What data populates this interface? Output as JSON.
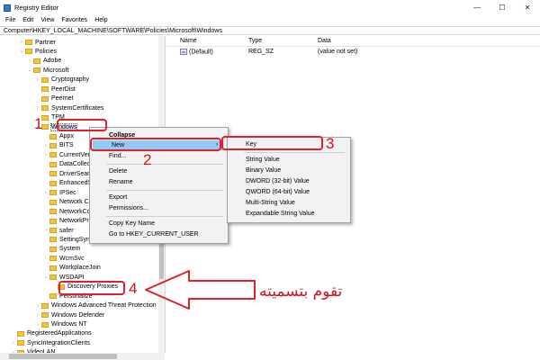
{
  "window": {
    "title": "Registry Editor",
    "controls": {
      "minimize": "—",
      "maximize": "☐",
      "close": "✕"
    }
  },
  "menubar": {
    "items": [
      "File",
      "Edit",
      "View",
      "Favorites",
      "Help"
    ]
  },
  "address": "Computer\\HKEY_LOCAL_MACHINE\\SOFTWARE\\Policies\\Microsoft\\Windows",
  "tree": {
    "items": [
      {
        "label": "Partner",
        "depth": 2,
        "expander": "›"
      },
      {
        "label": "Policies",
        "depth": 2,
        "expander": "⌄"
      },
      {
        "label": "Adobe",
        "depth": 3,
        "expander": "›"
      },
      {
        "label": "Microsoft",
        "depth": 3,
        "expander": "⌄"
      },
      {
        "label": "Cryptography",
        "depth": 4,
        "expander": "›"
      },
      {
        "label": "PeerDist",
        "depth": 4,
        "expander": ""
      },
      {
        "label": "Peernet",
        "depth": 4,
        "expander": ""
      },
      {
        "label": "SystemCertificates",
        "depth": 4,
        "expander": "›"
      },
      {
        "label": "TPM",
        "depth": 4,
        "expander": ""
      },
      {
        "label": "Windows",
        "depth": 4,
        "expander": "⌄"
      },
      {
        "label": "Appx",
        "depth": 5,
        "expander": ""
      },
      {
        "label": "BITS",
        "depth": 5,
        "expander": "›"
      },
      {
        "label": "CurrentVersion",
        "depth": 5,
        "expander": "›"
      },
      {
        "label": "DataCollection",
        "depth": 5,
        "expander": ""
      },
      {
        "label": "DriverSearching",
        "depth": 5,
        "expander": ""
      },
      {
        "label": "EnhancedStorageDevices",
        "depth": 5,
        "expander": ""
      },
      {
        "label": "IPSec",
        "depth": 5,
        "expander": "›"
      },
      {
        "label": "Network Connections",
        "depth": 5,
        "expander": ""
      },
      {
        "label": "NetworkConnectivityStatusIndicator",
        "depth": 5,
        "expander": ""
      },
      {
        "label": "NetworkProvider",
        "depth": 5,
        "expander": ""
      },
      {
        "label": "safer",
        "depth": 5,
        "expander": "›"
      },
      {
        "label": "SettingSync",
        "depth": 5,
        "expander": ""
      },
      {
        "label": "System",
        "depth": 5,
        "expander": ""
      },
      {
        "label": "WcmSvc",
        "depth": 5,
        "expander": "›"
      },
      {
        "label": "WorkplaceJoin",
        "depth": 5,
        "expander": ""
      },
      {
        "label": "WSDAPI",
        "depth": 5,
        "expander": "⌄"
      },
      {
        "label": "Discovery Proxies",
        "depth": 6,
        "expander": ""
      },
      {
        "label": "Personalize",
        "depth": 5,
        "expander": ""
      },
      {
        "label": "Windows Advanced Threat Protection",
        "depth": 4,
        "expander": "›"
      },
      {
        "label": "Windows Defender",
        "depth": 4,
        "expander": "›"
      },
      {
        "label": "Windows NT",
        "depth": 4,
        "expander": "›"
      },
      {
        "label": "RegisteredApplications",
        "depth": 1,
        "expander": ""
      },
      {
        "label": "SyncIntegrationClients",
        "depth": 1,
        "expander": "›"
      },
      {
        "label": "VideoLAN",
        "depth": 1,
        "expander": "›"
      }
    ]
  },
  "list": {
    "columns": [
      "Name",
      "Type",
      "Data"
    ],
    "rows": [
      {
        "name": "(Default)",
        "type": "REG_SZ",
        "data": "(value not set)",
        "icon": "ab"
      }
    ]
  },
  "context_menu": {
    "items": [
      "Collapse",
      "New",
      "Find...",
      "Delete",
      "Rename",
      "Export",
      "Permissions...",
      "Copy Key Name",
      "Go to HKEY_CURRENT_USER"
    ],
    "submenu_arrow": "›"
  },
  "submenu": {
    "items": [
      "Key",
      "String Value",
      "Binary Value",
      "DWORD (32-bit) Value",
      "QWORD (64-bit) Value",
      "Multi-String Value",
      "Expandable String Value"
    ]
  },
  "annotations": {
    "n1": "1",
    "n2": "2",
    "n3": "3",
    "n4": "4",
    "arabic_text": "تقوم بتسميته",
    "color": "#e0202a"
  }
}
